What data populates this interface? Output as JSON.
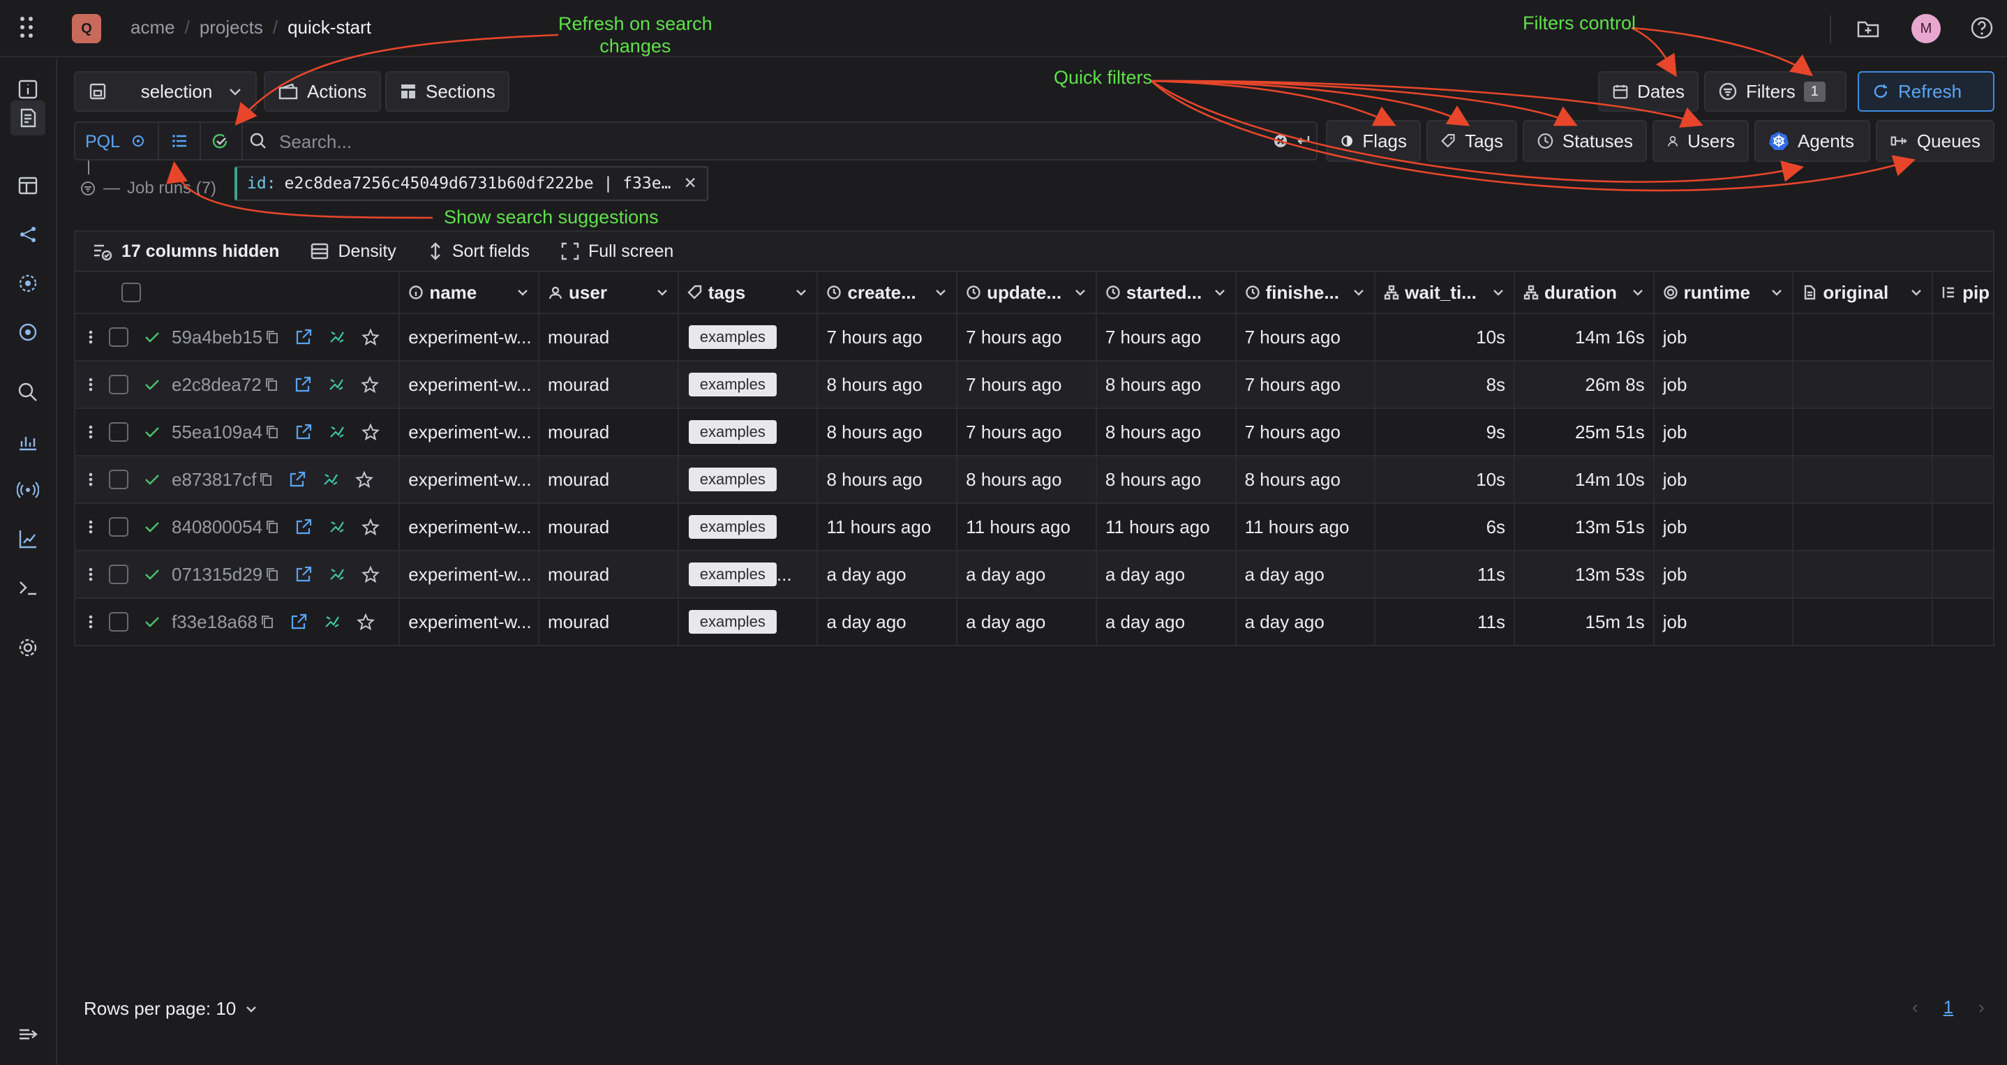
{
  "header": {
    "logo_letter": "Q",
    "breadcrumb": [
      "acme",
      "projects",
      "quick-start"
    ],
    "avatar_letter": "M"
  },
  "nav_icons": [
    "info-icon",
    "runs-icon",
    "dashboard-icon",
    "dag-icon",
    "agents-icon",
    "monitor-icon",
    "search-analytics-icon",
    "chart-icon",
    "broadcast-icon",
    "reports-icon",
    "terminal-icon",
    "settings-icon",
    "collapse-icon"
  ],
  "toolbar_top": {
    "selection": "selection",
    "actions": "Actions",
    "sections": "Sections",
    "dates": "Dates",
    "filters": "Filters",
    "filters_count": "1",
    "refresh": "Refresh"
  },
  "search": {
    "pql": "PQL",
    "placeholder": "Search...",
    "quick_filters": [
      "Flags",
      "Tags",
      "Statuses",
      "Users",
      "Agents",
      "Queues"
    ]
  },
  "jobruns": "Job runs (7)",
  "chip": {
    "key": "id:",
    "value": "e2c8dea7256c45049d6731b60df222be | f33e…"
  },
  "grid_toolbar": {
    "hidden": "17 columns hidden",
    "density": "Density",
    "sort": "Sort fields",
    "fullscreen": "Full screen"
  },
  "columns": [
    "name",
    "user",
    "tags",
    "create...",
    "update...",
    "started...",
    "finishe...",
    "wait_ti...",
    "duration",
    "runtime",
    "original",
    "pip"
  ],
  "rows": [
    {
      "uuid": "59a4beb15",
      "name": "experiment-w...",
      "user": "mourad",
      "tag": "examples",
      "created": "7 hours ago",
      "updated": "7 hours ago",
      "started": "7 hours ago",
      "finished": "7 hours ago",
      "wait": "10s",
      "duration": "14m 16s",
      "runtime": "job"
    },
    {
      "uuid": "e2c8dea72",
      "name": "experiment-w...",
      "user": "mourad",
      "tag": "examples",
      "created": "8 hours ago",
      "updated": "7 hours ago",
      "started": "8 hours ago",
      "finished": "7 hours ago",
      "wait": "8s",
      "duration": "26m 8s",
      "runtime": "job"
    },
    {
      "uuid": "55ea109a4",
      "name": "experiment-w...",
      "user": "mourad",
      "tag": "examples",
      "created": "8 hours ago",
      "updated": "7 hours ago",
      "started": "8 hours ago",
      "finished": "7 hours ago",
      "wait": "9s",
      "duration": "25m 51s",
      "runtime": "job"
    },
    {
      "uuid": "e873817cf",
      "name": "experiment-w...",
      "user": "mourad",
      "tag": "examples",
      "created": "8 hours ago",
      "updated": "8 hours ago",
      "started": "8 hours ago",
      "finished": "8 hours ago",
      "wait": "10s",
      "duration": "14m 10s",
      "runtime": "job"
    },
    {
      "uuid": "840800054",
      "name": "experiment-w...",
      "user": "mourad",
      "tag": "examples",
      "created": "11 hours ago",
      "updated": "11 hours ago",
      "started": "11 hours ago",
      "finished": "11 hours ago",
      "wait": "6s",
      "duration": "13m 51s",
      "runtime": "job"
    },
    {
      "uuid": "071315d29",
      "name": "experiment-w...",
      "user": "mourad",
      "tag": "examples",
      "tag_more": "...",
      "created": "a day ago",
      "updated": "a day ago",
      "started": "a day ago",
      "finished": "a day ago",
      "wait": "11s",
      "duration": "13m 53s",
      "runtime": "job"
    },
    {
      "uuid": "f33e18a68",
      "name": "experiment-w...",
      "user": "mourad",
      "tag": "examples",
      "created": "a day ago",
      "updated": "a day ago",
      "started": "a day ago",
      "finished": "a day ago",
      "wait": "11s",
      "duration": "15m 1s",
      "runtime": "job"
    }
  ],
  "pagination": {
    "rows_per_page": "Rows per page: 10",
    "page": "1"
  },
  "annotations": {
    "refresh_on_search": "Refresh on search\nchanges",
    "filters_control": "Filters control",
    "quick_filters": "Quick filters",
    "show_suggestions": "Show search suggestions"
  },
  "colors": {
    "accent": "#5aa5f5",
    "annotation_text": "#5fe04a",
    "annotation_arrow": "#e8462a",
    "success": "#4cc36b"
  }
}
